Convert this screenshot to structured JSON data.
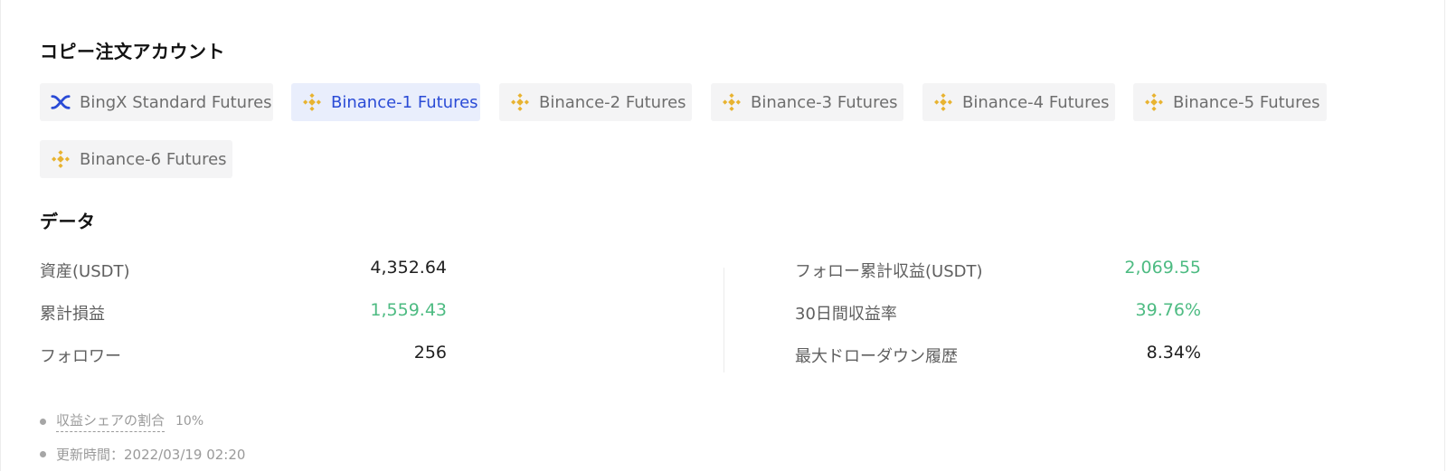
{
  "sections": {
    "copy_accounts_title": "コピー注文アカウント",
    "data_title": "データ"
  },
  "accounts": [
    {
      "label": "BingX Standard Futures",
      "icon": "bingx-logo-icon",
      "active": false
    },
    {
      "label": "Binance-1 Futures",
      "icon": "binance-logo-icon",
      "active": true
    },
    {
      "label": "Binance-2 Futures",
      "icon": "binance-logo-icon",
      "active": false
    },
    {
      "label": "Binance-3 Futures",
      "icon": "binance-logo-icon",
      "active": false
    },
    {
      "label": "Binance-4 Futures",
      "icon": "binance-logo-icon",
      "active": false
    },
    {
      "label": "Binance-5 Futures",
      "icon": "binance-logo-icon",
      "active": false
    },
    {
      "label": "Binance-6 Futures",
      "icon": "binance-logo-icon",
      "active": false
    }
  ],
  "stats": {
    "left": [
      {
        "label": "資産(USDT)",
        "value": "4,352.64",
        "positive": false
      },
      {
        "label": "累計損益",
        "value": "1,559.43",
        "positive": true
      },
      {
        "label": "フォロワー",
        "value": "256",
        "positive": false
      }
    ],
    "right": [
      {
        "label": "フォロー累計収益(USDT)",
        "value": "2,069.55",
        "positive": true
      },
      {
        "label": "30日間収益率",
        "value": "39.76%",
        "positive": true
      },
      {
        "label": "最大ドローダウン履歴",
        "value": "8.34%",
        "positive": false
      }
    ]
  },
  "notes": {
    "profit_share_label": "収益シェアの割合",
    "profit_share_value": "10%",
    "updated": "更新時間：2022/03/19 02:20"
  },
  "colors": {
    "accent": "#2a4bd6",
    "positive": "#4dbb82",
    "binance_yellow": "#e8b330",
    "bingx_blue": "#2a4bd6"
  }
}
